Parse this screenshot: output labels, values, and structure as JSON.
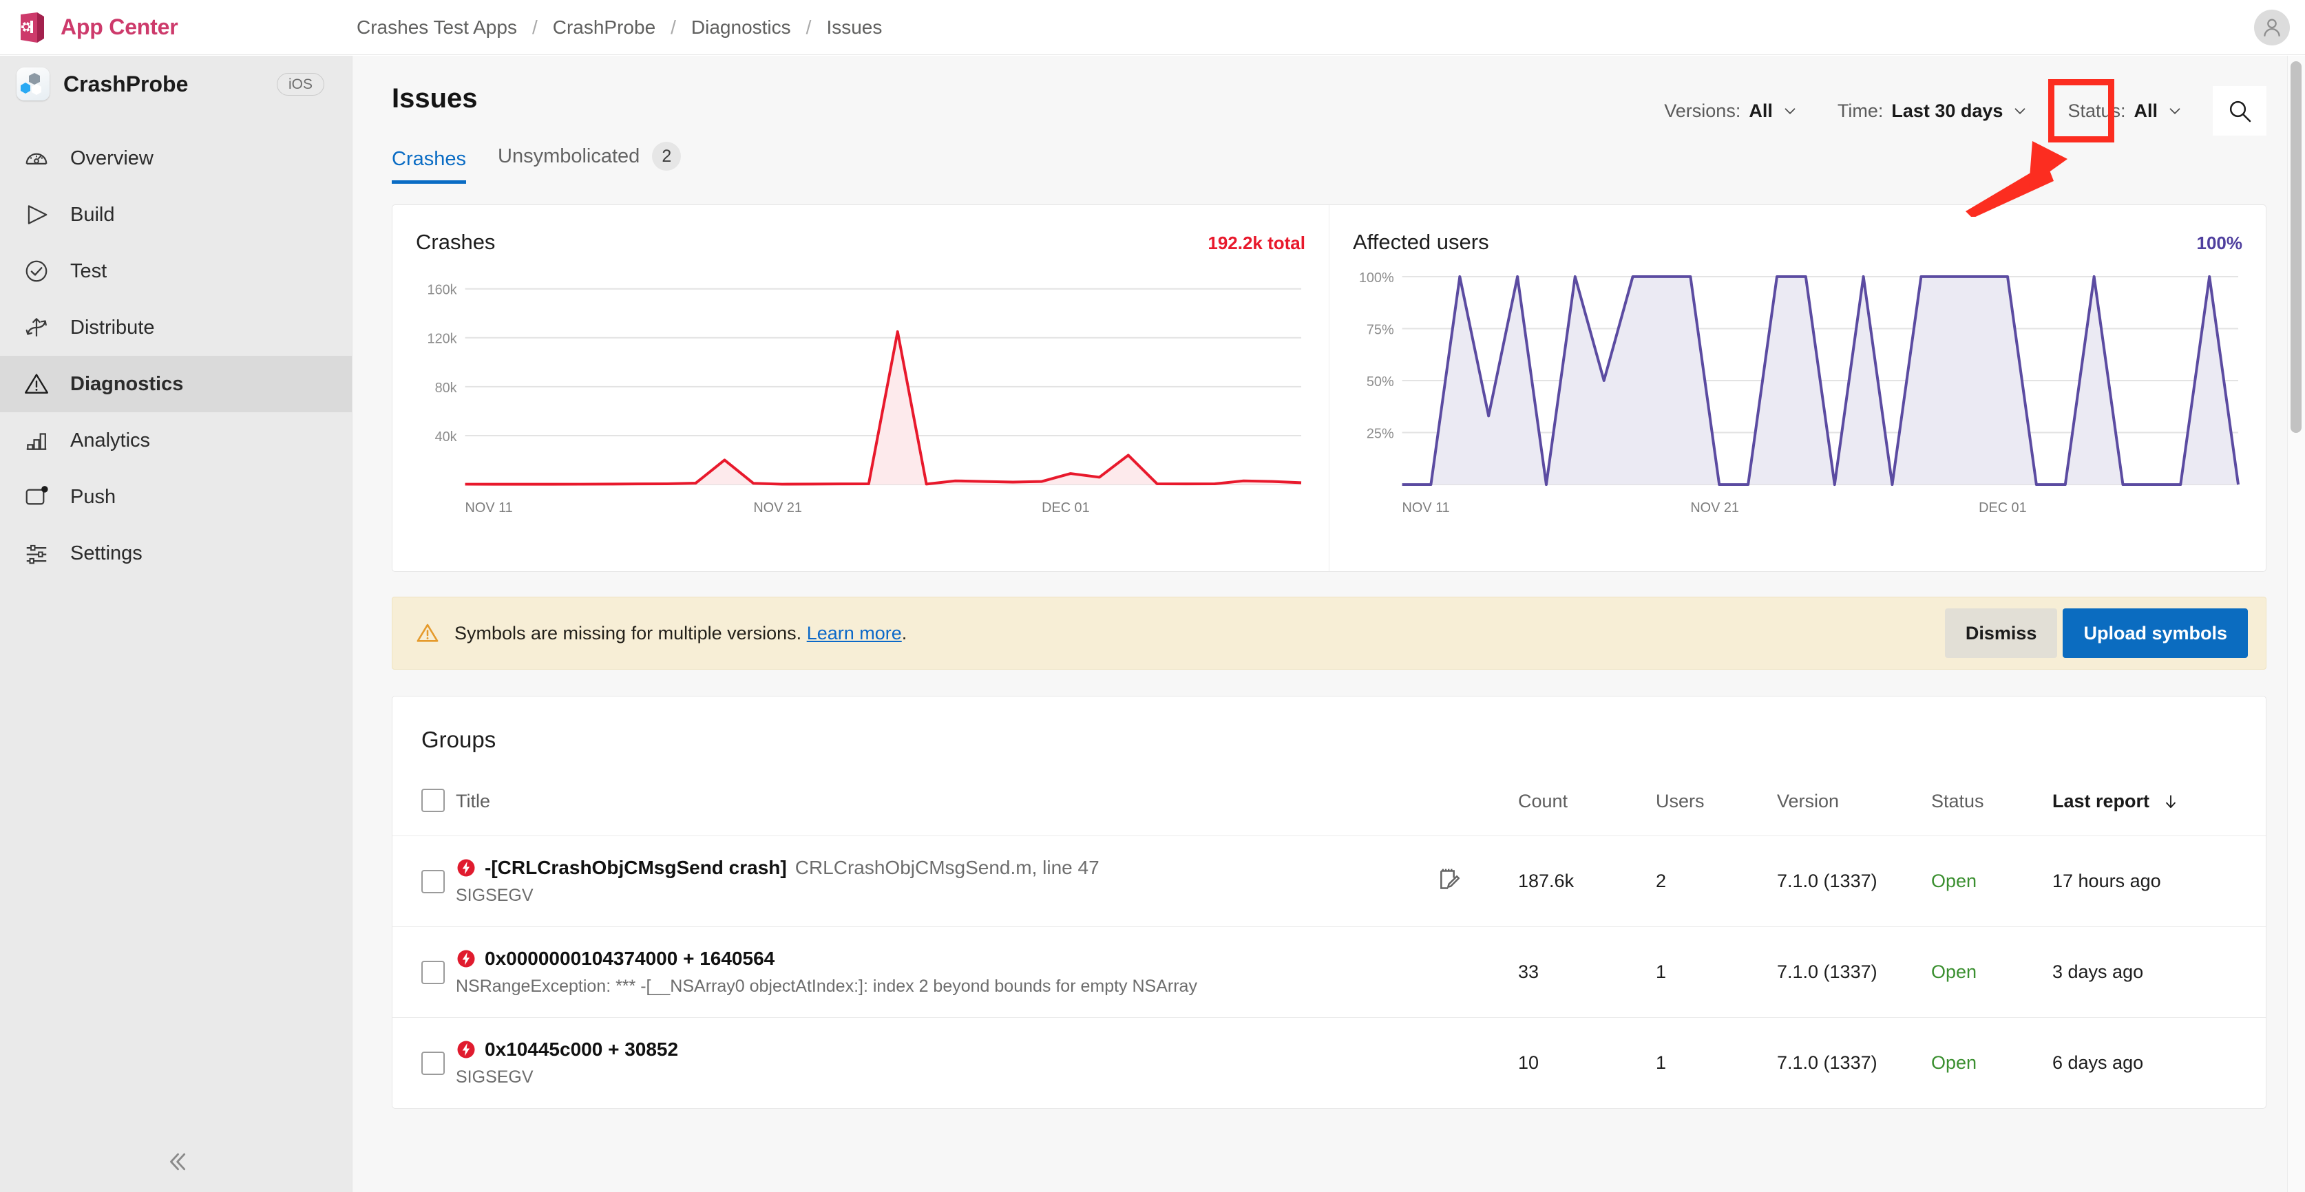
{
  "topbar": {
    "brand": "App Center",
    "brand_logo_icon": "app-center-logo-icon",
    "breadcrumb": [
      "Crashes Test Apps",
      "CrashProbe",
      "Diagnostics",
      "Issues"
    ],
    "breadcrumb_separator": "/",
    "avatar_icon": "user-avatar-icon"
  },
  "sidebar": {
    "app_name": "CrashProbe",
    "app_icon": "crashprobe-app-icon",
    "os_badge": "iOS",
    "items": [
      {
        "label": "Overview",
        "icon": "gauge-icon",
        "active": false
      },
      {
        "label": "Build",
        "icon": "play-triangle-icon",
        "active": false
      },
      {
        "label": "Test",
        "icon": "check-circle-icon",
        "active": false
      },
      {
        "label": "Distribute",
        "icon": "distribute-icon",
        "active": false
      },
      {
        "label": "Diagnostics",
        "icon": "warning-triangle-icon",
        "active": true
      },
      {
        "label": "Analytics",
        "icon": "bar-chart-icon",
        "active": false
      },
      {
        "label": "Push",
        "icon": "push-notification-icon",
        "active": false
      },
      {
        "label": "Settings",
        "icon": "sliders-icon",
        "active": false
      }
    ],
    "collapse_icon": "chevron-double-left-icon"
  },
  "page": {
    "title": "Issues",
    "filters": [
      {
        "label": "Versions:",
        "value": "All",
        "chevron": "chevron-down-icon"
      },
      {
        "label": "Time:",
        "value": "Last 30 days",
        "chevron": "chevron-down-icon"
      },
      {
        "label": "Status:",
        "value": "All",
        "chevron": "chevron-down-icon"
      }
    ],
    "search_icon": "search-icon",
    "tabs": [
      {
        "label": "Crashes",
        "badge": "",
        "active": true
      },
      {
        "label": "Unsymbolicated",
        "badge": "2",
        "active": false
      }
    ]
  },
  "annotation": {
    "highlight_color": "#fc2d20",
    "target": "search-button"
  },
  "banner": {
    "icon": "warning-triangle-icon",
    "text": "Symbols are missing for multiple versions.",
    "link_text": "Learn more",
    "text_tail": ".",
    "dismiss_label": "Dismiss",
    "upload_label": "Upload symbols"
  },
  "groups": {
    "heading": "Groups",
    "columns": [
      "Title",
      "Count",
      "Users",
      "Version",
      "Status",
      "Last report"
    ],
    "sort_column": "Last report",
    "sort_icon": "arrow-down-icon",
    "rows": [
      {
        "title_main": "-[CRLCrashObjCMsgSend crash]",
        "title_sub": "CRLCrashObjCMsgSend.m, line 47",
        "subtext": "SIGSEGV",
        "has_note": true,
        "note_icon": "note-edit-icon",
        "count": "187.6k",
        "users": "2",
        "version": "7.1.0 (1337)",
        "status": "Open",
        "last_report": "17 hours ago"
      },
      {
        "title_main": "0x0000000104374000 + 1640564",
        "title_sub": "",
        "subtext": "NSRangeException: *** -[__NSArray0 objectAtIndex:]: index 2 beyond bounds for empty NSArray",
        "has_note": false,
        "note_icon": "",
        "count": "33",
        "users": "1",
        "version": "7.1.0 (1337)",
        "status": "Open",
        "last_report": "3 days ago"
      },
      {
        "title_main": "0x10445c000 + 30852",
        "title_sub": "",
        "subtext": "SIGSEGV",
        "has_note": false,
        "note_icon": "",
        "count": "10",
        "users": "1",
        "version": "7.1.0 (1337)",
        "status": "Open",
        "last_report": "6 days ago"
      }
    ]
  },
  "chart_data": [
    {
      "type": "area",
      "title": "Crashes",
      "total_label": "192.2k total",
      "color": "#e8192c",
      "fill": "#fdeaec",
      "xlabel": "",
      "ylabel": "",
      "ylim": [
        0,
        170000
      ],
      "yticks": [
        40000,
        80000,
        120000,
        160000
      ],
      "ytick_labels": [
        "40k",
        "80k",
        "120k",
        "160k"
      ],
      "xtick_labels": [
        "NOV 11",
        "NOV 21",
        "DEC 01"
      ],
      "xtick_positions": [
        0,
        10,
        20
      ],
      "grid": true,
      "x": [
        0,
        1,
        2,
        3,
        4,
        5,
        6,
        7,
        8,
        9,
        10,
        11,
        12,
        13,
        14,
        15,
        16,
        17,
        18,
        19,
        20,
        21,
        22,
        23,
        24,
        25,
        26,
        27,
        28,
        29
      ],
      "values": [
        300,
        200,
        250,
        200,
        300,
        400,
        500,
        600,
        1200,
        20000,
        1000,
        300,
        400,
        500,
        600,
        125000,
        400,
        3000,
        2500,
        2000,
        2500,
        9000,
        6000,
        24000,
        600,
        500,
        600,
        3000,
        2500,
        1500
      ]
    },
    {
      "type": "area",
      "title": "Affected users",
      "total_label": "100%",
      "color": "#5b4ba1",
      "fill": "#ebeaf3",
      "xlabel": "",
      "ylabel": "",
      "ylim": [
        0,
        100
      ],
      "yticks": [
        25,
        50,
        75,
        100
      ],
      "ytick_labels": [
        "25%",
        "50%",
        "75%",
        "100%"
      ],
      "xtick_labels": [
        "NOV 11",
        "NOV 21",
        "DEC 01"
      ],
      "xtick_positions": [
        0,
        10,
        20
      ],
      "grid": true,
      "x": [
        0,
        1,
        2,
        3,
        4,
        5,
        6,
        7,
        8,
        9,
        10,
        11,
        12,
        13,
        14,
        15,
        16,
        17,
        18,
        19,
        20,
        21,
        22,
        23,
        24,
        25,
        26,
        27,
        28,
        29
      ],
      "values": [
        0,
        0,
        100,
        33,
        100,
        0,
        100,
        50,
        100,
        100,
        100,
        0,
        0,
        100,
        100,
        0,
        100,
        0,
        100,
        100,
        100,
        100,
        0,
        0,
        100,
        0,
        0,
        0,
        100,
        0
      ]
    }
  ]
}
